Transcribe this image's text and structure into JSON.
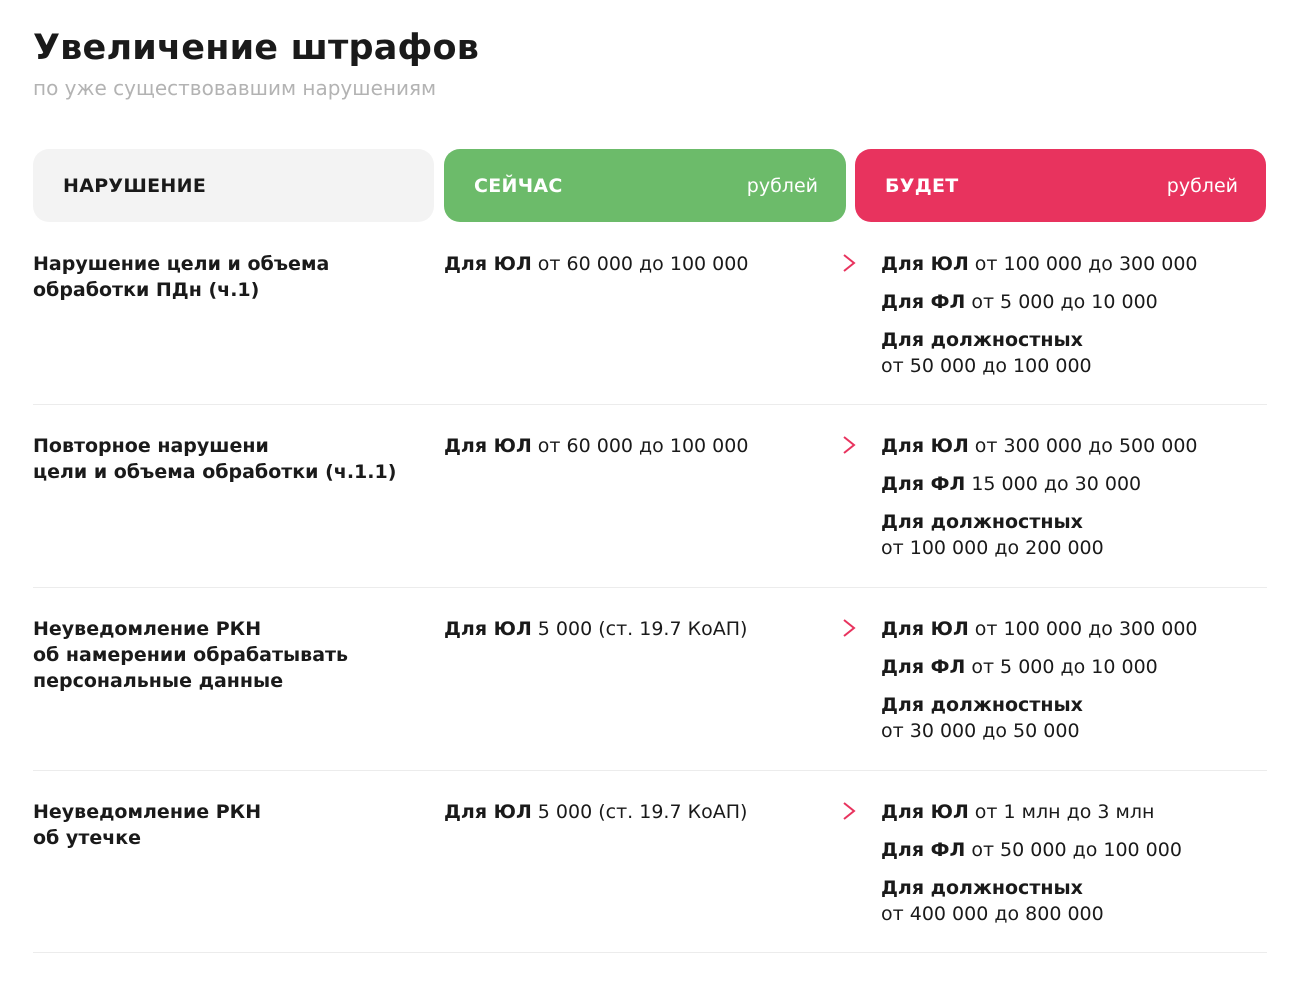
{
  "header": {
    "title": "Увеличение штрафов",
    "subtitle": "по уже существовавшим нарушениям"
  },
  "columns": {
    "violation": "НАРУШЕНИЕ",
    "now": {
      "label": "СЕЙЧАС",
      "unit": "рублей"
    },
    "will": {
      "label": "БУДЕТ",
      "unit": "рублей"
    }
  },
  "colors": {
    "now_accent": "#6cbb6a",
    "will_accent": "#e8335e",
    "arrow": "#e8335e"
  },
  "arrow_icon": "right-arrow-icon",
  "rows": [
    {
      "violation": "Нарушение цели и объема\nобработки ПДн (ч.1)",
      "now": {
        "label": "Для ЮЛ",
        "value": "от 60 000 до 100 000"
      },
      "will": {
        "ul": {
          "label": "Для ЮЛ",
          "value": "от 100 000 до 300 000"
        },
        "fl": {
          "label": "Для ФЛ",
          "value": "от 5 000 до 10 000"
        },
        "official": {
          "label": "Для должностных",
          "value": "от 50 000 до 100 000"
        }
      }
    },
    {
      "violation": "Повторное нарушени\nцели и объема обработки (ч.1.1)",
      "now": {
        "label": "Для ЮЛ",
        "value": "от 60 000 до 100 000"
      },
      "will": {
        "ul": {
          "label": "Для ЮЛ",
          "value": "от 300 000 до 500 000"
        },
        "fl": {
          "label": "Для ФЛ",
          "value": "15 000 до 30 000"
        },
        "official": {
          "label": "Для должностных",
          "value": "от 100 000 до 200 000"
        }
      }
    },
    {
      "violation": "Неуведомление РКН\nоб намерении обрабатывать\nперсональные данные",
      "now": {
        "label": "Для ЮЛ",
        "value": "5 000 (ст. 19.7 КоАП)"
      },
      "will": {
        "ul": {
          "label": "Для ЮЛ",
          "value": "от 100 000 до 300 000"
        },
        "fl": {
          "label": "Для ФЛ",
          "value": "от 5 000 до 10 000"
        },
        "official": {
          "label": "Для должностных",
          "value": "от 30 000 до 50 000"
        }
      }
    },
    {
      "violation": "Неуведомление РКН\nоб утечке",
      "now": {
        "label": "Для ЮЛ",
        "value": "5 000 (ст. 19.7 КоАП)"
      },
      "will": {
        "ul": {
          "label": "Для ЮЛ",
          "value": "от 1 млн до 3 млн"
        },
        "fl": {
          "label": "Для ФЛ",
          "value": "от 50 000 до 100 000"
        },
        "official": {
          "label": "Для должностных",
          "value": "от 400 000 до 800 000"
        }
      }
    }
  ]
}
